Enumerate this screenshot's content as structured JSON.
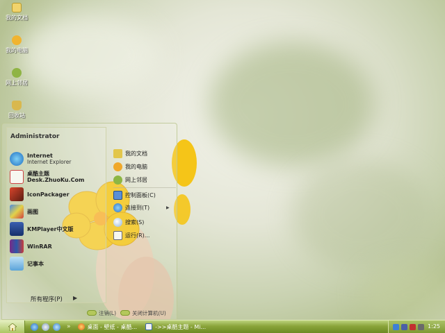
{
  "desktop_icons": [
    {
      "label": "我的文档",
      "icon": "folder-documents-icon"
    },
    {
      "label": "我的电脑",
      "icon": "my-computer-icon"
    },
    {
      "label": "网上邻居",
      "icon": "network-places-icon"
    },
    {
      "label": "回收站",
      "icon": "recycle-bin-icon"
    }
  ],
  "start_menu": {
    "user": "Administrator",
    "pinned": [
      {
        "label": "Internet",
        "sub": "Internet Explorer",
        "icon": "internet-explorer-icon"
      }
    ],
    "programs": [
      {
        "label": "桌酷主题Desk.ZhuoKu.Com",
        "icon": "zhuoku-theme-icon"
      },
      {
        "label": "IconPackager",
        "icon": "iconpackager-icon"
      },
      {
        "label": "画图",
        "icon": "paint-icon"
      },
      {
        "label": "KMPlayer中文版",
        "icon": "kmplayer-icon"
      },
      {
        "label": "WinRAR",
        "icon": "winrar-icon"
      },
      {
        "label": "记事本",
        "icon": "notepad-icon"
      }
    ],
    "all_programs": "所有程序(P)",
    "right_top": [
      {
        "label": "我的文档",
        "icon": "my-documents-icon"
      },
      {
        "label": "我的电脑",
        "icon": "my-computer-icon"
      },
      {
        "label": "网上邻居",
        "icon": "network-places-icon"
      }
    ],
    "right_bottom": [
      {
        "label": "控制面板(C)",
        "icon": "control-panel-icon"
      },
      {
        "label": "连接到(T)",
        "icon": "connect-to-icon"
      },
      {
        "label": "搜索(S)",
        "icon": "search-icon"
      },
      {
        "label": "运行(R)...",
        "icon": "run-icon"
      }
    ],
    "logoff": "注销(L)",
    "shutdown": "关闭计算机(U)"
  },
  "taskbar": {
    "tasks": [
      {
        "label": "桌面 - 壁纸 - 桌酷...",
        "icon": "browser-icon"
      },
      {
        "label": "->>桌酷主题 - Mi...",
        "icon": "document-icon"
      }
    ],
    "clock": "1:25"
  },
  "colors": {
    "taskbar": "#8aa43a",
    "flower": "#f5c518",
    "accent_green": "#b4c85c"
  }
}
